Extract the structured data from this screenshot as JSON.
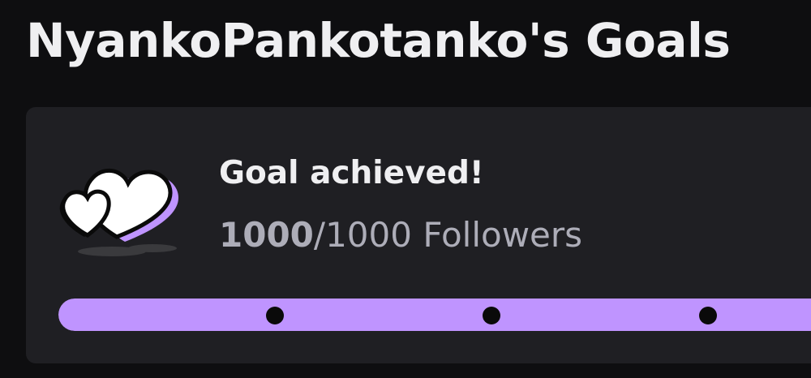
{
  "page": {
    "title": "NyankoPankotanko's Goals"
  },
  "goal": {
    "icon": "hearts-icon",
    "status": "Goal achieved!",
    "current": "1000",
    "separator": "/",
    "target": "1000",
    "unit": "Followers",
    "progress_fraction": 1.0,
    "milestones": [
      0.25,
      0.5,
      0.75
    ],
    "colors": {
      "accent": "#bf94ff",
      "card": "#1f1f23",
      "background": "#0e0e10"
    }
  }
}
